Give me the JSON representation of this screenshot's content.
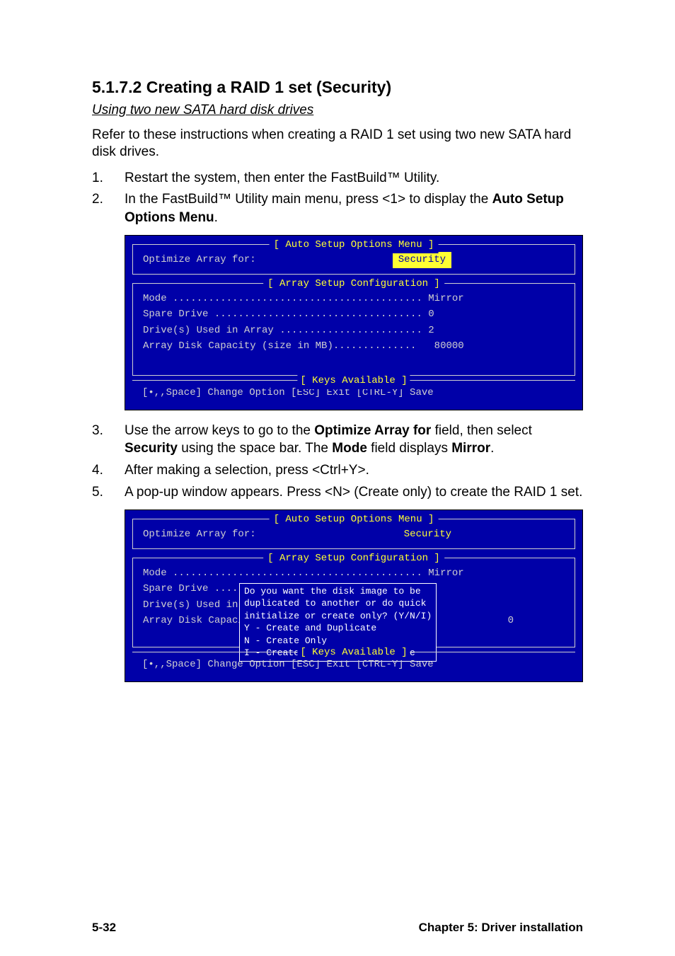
{
  "heading": "5.1.7.2 Creating a RAID 1 set (Security)",
  "subheading": "Using two new SATA hard disk drives",
  "intro": "Refer to these instructions when creating a RAID 1 set using two new SATA hard disk drives.",
  "steps": {
    "s1": {
      "num": "1.",
      "text": "Restart the system, then enter the FastBuild™ Utility."
    },
    "s2": {
      "num": "2.",
      "pre": "In the FastBuild™ Utility main menu, press <1> to display the ",
      "bold": "Auto Setup Options Menu",
      "post": "."
    },
    "s3": {
      "num": "3.",
      "pre": "Use the arrow keys to go to the ",
      "b1": "Optimize Array for",
      "mid1": " field, then select ",
      "b2": "Security",
      "mid2": " using the space bar. The ",
      "b3": "Mode",
      "mid3": " field displays ",
      "b4": "Mirror",
      "post": "."
    },
    "s4": {
      "num": "4.",
      "text": "After making a selection, press <Ctrl+Y>."
    },
    "s5": {
      "num": "5.",
      "text": "A pop-up window appears. Press <N> (Create only) to create the RAID 1 set."
    }
  },
  "bios1": {
    "menu_title": "[ Auto Setup Options Menu ]",
    "optimize_label": "Optimize Array for:",
    "optimize_value": "Security",
    "config_title": "[ Array Setup Configuration ]",
    "mode_line": "Mode .......................................... Mirror",
    "spare_line": "Spare Drive ................................... 0",
    "drives_line": "Drive(s) Used in Array ........................ 2",
    "capacity_line": "Array Disk Capacity (size in MB)..............   80000",
    "keys_title": "[ Keys Available ]",
    "keys_text": "[•,,Space] Change Option  [ESC] Exit  [CTRL-Y] Save"
  },
  "bios2": {
    "menu_title": "[ Auto Setup Options Menu ]",
    "optimize_label": "Optimize Array for:",
    "optimize_value": "Security",
    "config_title": "[ Array Setup Configuration ]",
    "mode_line": "Mode .......................................... Mirror",
    "left1": "Spare Drive .....",
    "left2": "Drive(s) Used in ",
    "left3": "Array Disk Capaci",
    "right3": "0",
    "popup": "Do you want the disk image to be\nduplicated to another or do quick\ninitialize or create only? (Y/N/I)\nY - Create and Duplicate\nN - Create Only\nI - Create and Quick Initialize",
    "keys_title": "[ Keys Available ]",
    "keys_text": "[•,,Space] Change Option  [ESC] Exit  [CTRL-Y] Save"
  },
  "footer": {
    "left": "5-32",
    "right": "Chapter 5:  Driver installation"
  }
}
